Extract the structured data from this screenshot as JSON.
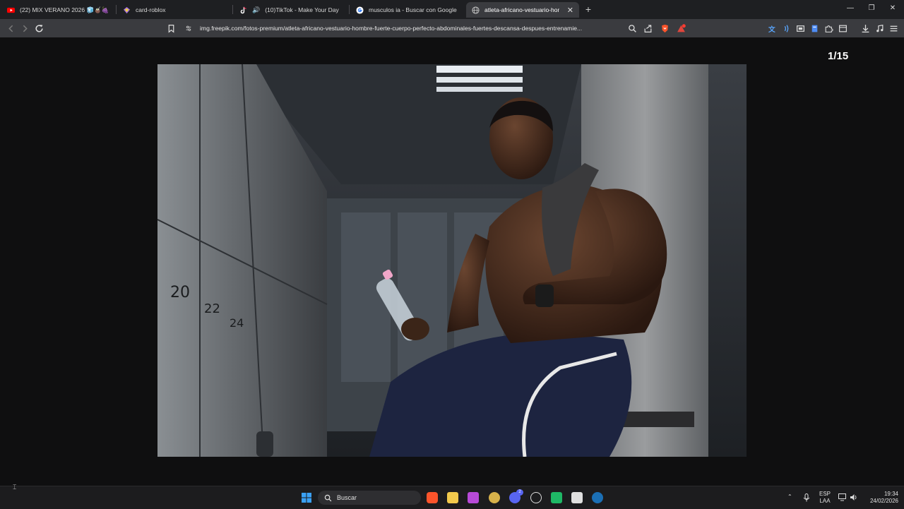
{
  "browser": {
    "tabs": [
      {
        "title": "(22) MIX VERANO 2026 🧊🧉🍇 (D/",
        "icon": "youtube-icon",
        "active": false
      },
      {
        "title": "card-roblox",
        "icon": "roblox-icon",
        "active": false
      },
      {
        "title": "(10)TikTok - Make Your Day",
        "icon": "tiktok-icon",
        "active": false
      },
      {
        "title": "musculos ia - Buscar con Google",
        "icon": "google-icon",
        "active": false
      },
      {
        "title": "atleta-africano-vestuario-hombre",
        "icon": "globe-icon",
        "active": true
      }
    ],
    "new_tab_label": "+",
    "address": "img.freepik.com/fotos-premium/atleta-africano-vestuario-hombre-fuerte-cuerpo-perfecto-abdominales-fuertes-descansa-despues-entrenamie..."
  },
  "viewer": {
    "counter": "1/15"
  },
  "photo": {
    "locker_numbers": [
      "20",
      "22",
      "24"
    ]
  },
  "taskbar": {
    "search_placeholder": "Buscar",
    "language": "ESP",
    "layout": "LAA",
    "time": "19:34",
    "date": "24/02/2026",
    "discord_badge": "2"
  },
  "colors": {
    "tab_bg": "#1e1f22",
    "toolbar_bg": "#3a3b3f",
    "brave_orange": "#fb542b",
    "page_bg": "#0f0f10"
  }
}
